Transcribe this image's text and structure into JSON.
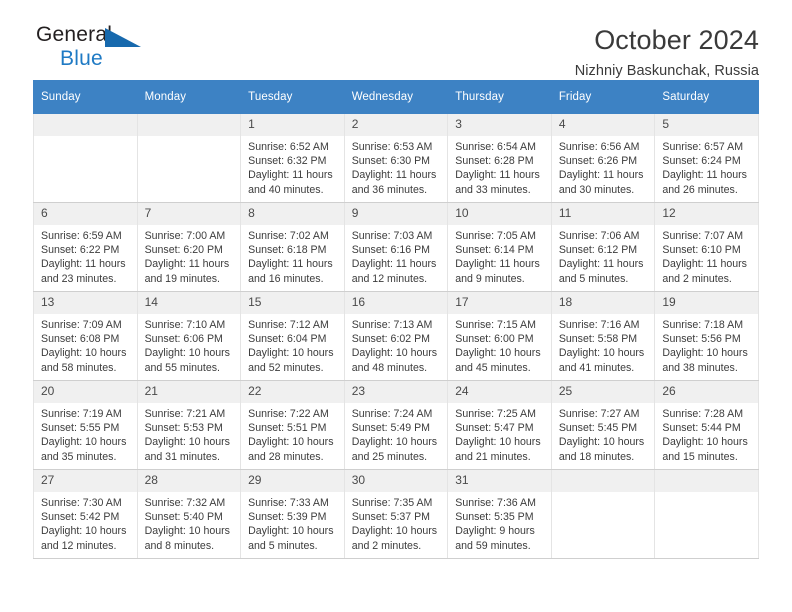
{
  "brand": {
    "line1": "General",
    "line2": "Blue",
    "triangle_icon": "blue-triangle-icon",
    "accent_color": "#1f7ac4",
    "text_color": "#231f20"
  },
  "header": {
    "title": "October 2024",
    "subtitle": "Nizhniy Baskunchak, Russia"
  },
  "calendar": {
    "header_background": "#3d82c4",
    "daynum_background": "#f0f0f0",
    "weekday_headers": [
      "Sunday",
      "Monday",
      "Tuesday",
      "Wednesday",
      "Thursday",
      "Friday",
      "Saturday"
    ],
    "weeks": [
      [
        {
          "day": "",
          "empty": true,
          "sunrise": "",
          "sunset": "",
          "daylight_line1": "",
          "daylight_line2": ""
        },
        {
          "day": "",
          "empty": true,
          "sunrise": "",
          "sunset": "",
          "daylight_line1": "",
          "daylight_line2": ""
        },
        {
          "day": "1",
          "empty": false,
          "sunrise": "Sunrise: 6:52 AM",
          "sunset": "Sunset: 6:32 PM",
          "daylight_line1": "Daylight: 11 hours",
          "daylight_line2": "and 40 minutes."
        },
        {
          "day": "2",
          "empty": false,
          "sunrise": "Sunrise: 6:53 AM",
          "sunset": "Sunset: 6:30 PM",
          "daylight_line1": "Daylight: 11 hours",
          "daylight_line2": "and 36 minutes."
        },
        {
          "day": "3",
          "empty": false,
          "sunrise": "Sunrise: 6:54 AM",
          "sunset": "Sunset: 6:28 PM",
          "daylight_line1": "Daylight: 11 hours",
          "daylight_line2": "and 33 minutes."
        },
        {
          "day": "4",
          "empty": false,
          "sunrise": "Sunrise: 6:56 AM",
          "sunset": "Sunset: 6:26 PM",
          "daylight_line1": "Daylight: 11 hours",
          "daylight_line2": "and 30 minutes."
        },
        {
          "day": "5",
          "empty": false,
          "sunrise": "Sunrise: 6:57 AM",
          "sunset": "Sunset: 6:24 PM",
          "daylight_line1": "Daylight: 11 hours",
          "daylight_line2": "and 26 minutes."
        }
      ],
      [
        {
          "day": "6",
          "empty": false,
          "sunrise": "Sunrise: 6:59 AM",
          "sunset": "Sunset: 6:22 PM",
          "daylight_line1": "Daylight: 11 hours",
          "daylight_line2": "and 23 minutes."
        },
        {
          "day": "7",
          "empty": false,
          "sunrise": "Sunrise: 7:00 AM",
          "sunset": "Sunset: 6:20 PM",
          "daylight_line1": "Daylight: 11 hours",
          "daylight_line2": "and 19 minutes."
        },
        {
          "day": "8",
          "empty": false,
          "sunrise": "Sunrise: 7:02 AM",
          "sunset": "Sunset: 6:18 PM",
          "daylight_line1": "Daylight: 11 hours",
          "daylight_line2": "and 16 minutes."
        },
        {
          "day": "9",
          "empty": false,
          "sunrise": "Sunrise: 7:03 AM",
          "sunset": "Sunset: 6:16 PM",
          "daylight_line1": "Daylight: 11 hours",
          "daylight_line2": "and 12 minutes."
        },
        {
          "day": "10",
          "empty": false,
          "sunrise": "Sunrise: 7:05 AM",
          "sunset": "Sunset: 6:14 PM",
          "daylight_line1": "Daylight: 11 hours",
          "daylight_line2": "and 9 minutes."
        },
        {
          "day": "11",
          "empty": false,
          "sunrise": "Sunrise: 7:06 AM",
          "sunset": "Sunset: 6:12 PM",
          "daylight_line1": "Daylight: 11 hours",
          "daylight_line2": "and 5 minutes."
        },
        {
          "day": "12",
          "empty": false,
          "sunrise": "Sunrise: 7:07 AM",
          "sunset": "Sunset: 6:10 PM",
          "daylight_line1": "Daylight: 11 hours",
          "daylight_line2": "and 2 minutes."
        }
      ],
      [
        {
          "day": "13",
          "empty": false,
          "sunrise": "Sunrise: 7:09 AM",
          "sunset": "Sunset: 6:08 PM",
          "daylight_line1": "Daylight: 10 hours",
          "daylight_line2": "and 58 minutes."
        },
        {
          "day": "14",
          "empty": false,
          "sunrise": "Sunrise: 7:10 AM",
          "sunset": "Sunset: 6:06 PM",
          "daylight_line1": "Daylight: 10 hours",
          "daylight_line2": "and 55 minutes."
        },
        {
          "day": "15",
          "empty": false,
          "sunrise": "Sunrise: 7:12 AM",
          "sunset": "Sunset: 6:04 PM",
          "daylight_line1": "Daylight: 10 hours",
          "daylight_line2": "and 52 minutes."
        },
        {
          "day": "16",
          "empty": false,
          "sunrise": "Sunrise: 7:13 AM",
          "sunset": "Sunset: 6:02 PM",
          "daylight_line1": "Daylight: 10 hours",
          "daylight_line2": "and 48 minutes."
        },
        {
          "day": "17",
          "empty": false,
          "sunrise": "Sunrise: 7:15 AM",
          "sunset": "Sunset: 6:00 PM",
          "daylight_line1": "Daylight: 10 hours",
          "daylight_line2": "and 45 minutes."
        },
        {
          "day": "18",
          "empty": false,
          "sunrise": "Sunrise: 7:16 AM",
          "sunset": "Sunset: 5:58 PM",
          "daylight_line1": "Daylight: 10 hours",
          "daylight_line2": "and 41 minutes."
        },
        {
          "day": "19",
          "empty": false,
          "sunrise": "Sunrise: 7:18 AM",
          "sunset": "Sunset: 5:56 PM",
          "daylight_line1": "Daylight: 10 hours",
          "daylight_line2": "and 38 minutes."
        }
      ],
      [
        {
          "day": "20",
          "empty": false,
          "sunrise": "Sunrise: 7:19 AM",
          "sunset": "Sunset: 5:55 PM",
          "daylight_line1": "Daylight: 10 hours",
          "daylight_line2": "and 35 minutes."
        },
        {
          "day": "21",
          "empty": false,
          "sunrise": "Sunrise: 7:21 AM",
          "sunset": "Sunset: 5:53 PM",
          "daylight_line1": "Daylight: 10 hours",
          "daylight_line2": "and 31 minutes."
        },
        {
          "day": "22",
          "empty": false,
          "sunrise": "Sunrise: 7:22 AM",
          "sunset": "Sunset: 5:51 PM",
          "daylight_line1": "Daylight: 10 hours",
          "daylight_line2": "and 28 minutes."
        },
        {
          "day": "23",
          "empty": false,
          "sunrise": "Sunrise: 7:24 AM",
          "sunset": "Sunset: 5:49 PM",
          "daylight_line1": "Daylight: 10 hours",
          "daylight_line2": "and 25 minutes."
        },
        {
          "day": "24",
          "empty": false,
          "sunrise": "Sunrise: 7:25 AM",
          "sunset": "Sunset: 5:47 PM",
          "daylight_line1": "Daylight: 10 hours",
          "daylight_line2": "and 21 minutes."
        },
        {
          "day": "25",
          "empty": false,
          "sunrise": "Sunrise: 7:27 AM",
          "sunset": "Sunset: 5:45 PM",
          "daylight_line1": "Daylight: 10 hours",
          "daylight_line2": "and 18 minutes."
        },
        {
          "day": "26",
          "empty": false,
          "sunrise": "Sunrise: 7:28 AM",
          "sunset": "Sunset: 5:44 PM",
          "daylight_line1": "Daylight: 10 hours",
          "daylight_line2": "and 15 minutes."
        }
      ],
      [
        {
          "day": "27",
          "empty": false,
          "sunrise": "Sunrise: 7:30 AM",
          "sunset": "Sunset: 5:42 PM",
          "daylight_line1": "Daylight: 10 hours",
          "daylight_line2": "and 12 minutes."
        },
        {
          "day": "28",
          "empty": false,
          "sunrise": "Sunrise: 7:32 AM",
          "sunset": "Sunset: 5:40 PM",
          "daylight_line1": "Daylight: 10 hours",
          "daylight_line2": "and 8 minutes."
        },
        {
          "day": "29",
          "empty": false,
          "sunrise": "Sunrise: 7:33 AM",
          "sunset": "Sunset: 5:39 PM",
          "daylight_line1": "Daylight: 10 hours",
          "daylight_line2": "and 5 minutes."
        },
        {
          "day": "30",
          "empty": false,
          "sunrise": "Sunrise: 7:35 AM",
          "sunset": "Sunset: 5:37 PM",
          "daylight_line1": "Daylight: 10 hours",
          "daylight_line2": "and 2 minutes."
        },
        {
          "day": "31",
          "empty": false,
          "sunrise": "Sunrise: 7:36 AM",
          "sunset": "Sunset: 5:35 PM",
          "daylight_line1": "Daylight: 9 hours",
          "daylight_line2": "and 59 minutes."
        },
        {
          "day": "",
          "empty": true,
          "sunrise": "",
          "sunset": "",
          "daylight_line1": "",
          "daylight_line2": ""
        },
        {
          "day": "",
          "empty": true,
          "sunrise": "",
          "sunset": "",
          "daylight_line1": "",
          "daylight_line2": ""
        }
      ]
    ]
  }
}
